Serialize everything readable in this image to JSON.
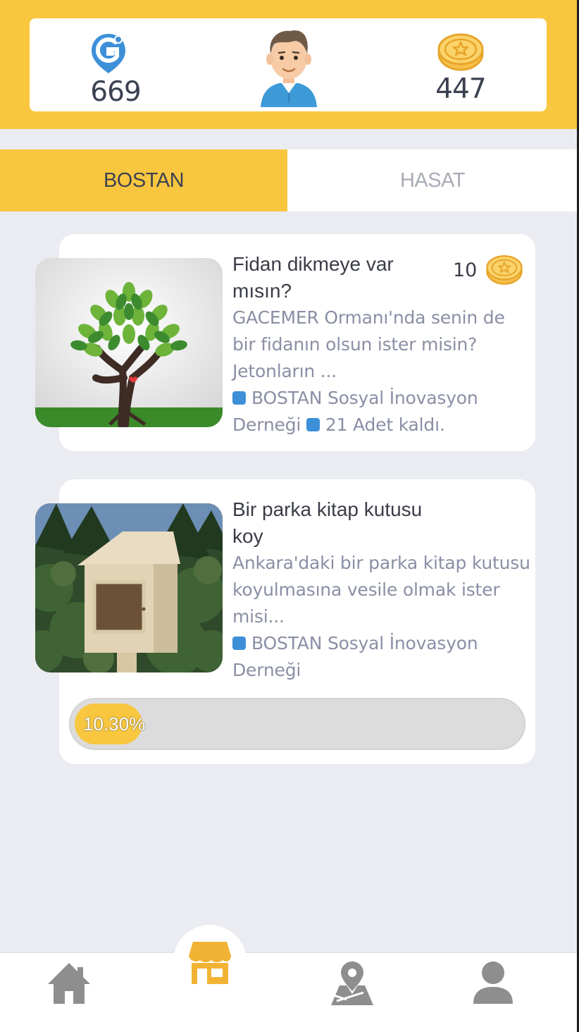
{
  "stats": {
    "points_value": "669",
    "coins_value": "447",
    "points_icon": "g-location-pin-icon",
    "coin_icon": "star-coin-icon"
  },
  "tabs": [
    {
      "label": "BOSTAN",
      "active": true
    },
    {
      "label": "HASAT",
      "active": false
    }
  ],
  "cards": [
    {
      "title_line1": "Fidan dikmeye var",
      "title_line2": "mısın?",
      "price": "10",
      "desc_line1": "GACEMER Ormanı'nda senin de",
      "desc_line2": "bir fidanın olsun ister misin?",
      "desc_line3": "Jetonların ...",
      "org_line1": "BOSTAN Sosyal İnovasyon",
      "org_line2": "Derneği",
      "remaining": "21 Adet kaldı.",
      "image": "tree-illustration"
    },
    {
      "title_line1": "Bir parka kitap kutusu",
      "title_line2": "koy",
      "desc_line1": "Ankara'daki bir parka kitap kutusu",
      "desc_line2": "koyulmasına vesile olmak ister",
      "desc_line3": "misi...",
      "org_line1": "BOSTAN Sosyal İnovasyon",
      "org_line2": "Derneği",
      "progress_label": "10.30%",
      "progress_value": 0.103,
      "image": "wooden-book-box-photo"
    }
  ],
  "bottom_nav": [
    {
      "icon": "home-icon",
      "active": false
    },
    {
      "icon": "store-icon",
      "active": true
    },
    {
      "icon": "map-pin-icon",
      "active": false
    },
    {
      "icon": "profile-icon",
      "active": false
    }
  ],
  "colors": {
    "accent_yellow": "#f8c73f",
    "icon_blue": "#3d8fd8",
    "coin_orange": "#f2b335",
    "nav_gray": "#8e8e8e"
  }
}
